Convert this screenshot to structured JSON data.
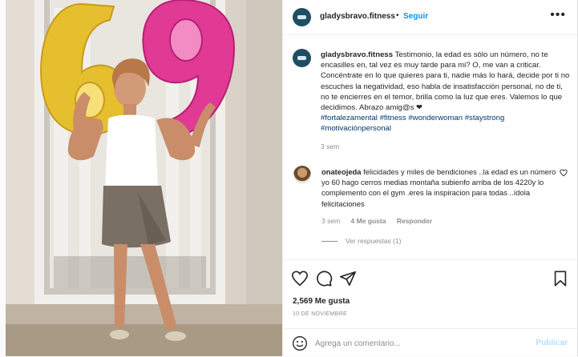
{
  "post": {
    "username": "gladysbravo.fitness",
    "separator": "•",
    "follow_label": "Seguir",
    "more_label": "•••"
  },
  "caption": {
    "username": "gladysbravo.fitness",
    "text": "Testimonio, la edad es sólo un número, no te encasilles en, tal vez es muy tarde para mi? O, me van a criticar. Concéntrate en lo que quieres para ti, nadie más lo hará, decide por ti no escuches la negatividad, eso habla de insatisfacción personal, no de ti, no te encierres en el temor, brilla como la luz que eres. Valemos lo que decidimos. Abrazo amig@s ❤",
    "hashtags": "#fortalezamental #fitness #wonderwoman #staystrong #motivaciónpersonal",
    "time": "3 sem"
  },
  "comment": {
    "username": "onateojeda",
    "text": "felicidades y miles de bendiciones ..la edad es un número yo 60 hago cerros medias montaña subienfo arriba de los 4220y lo complemento con el gym .eres la inspiracion para todas ..ídola felicitaciones",
    "time": "3 sem",
    "likes": "4 Me gusta",
    "reply_label": "Responder",
    "view_replies": "Ver respuestas (1)",
    "heart_icon": "heart-outline-icon"
  },
  "actions": {
    "icons": [
      "heart-icon",
      "comment-icon",
      "share-icon",
      "bookmark-icon"
    ],
    "like_count": "2,569 Me gusta",
    "date": "10 DE NOVIEMBRE"
  },
  "add_comment": {
    "placeholder": "Agrega un comentario...",
    "publish_label": "Publicar",
    "emoji_icon": "emoji-icon"
  },
  "photo": {
    "balloon_left": "6",
    "balloon_right": "9",
    "colors": {
      "gold": "#e8c43a",
      "magenta": "#e0348f",
      "top": "#ffffff",
      "skirt": "#7d7266"
    }
  },
  "colors": {
    "accent": "#0095f6",
    "muted": "#8e8e8e",
    "hashtag": "#00376b"
  }
}
